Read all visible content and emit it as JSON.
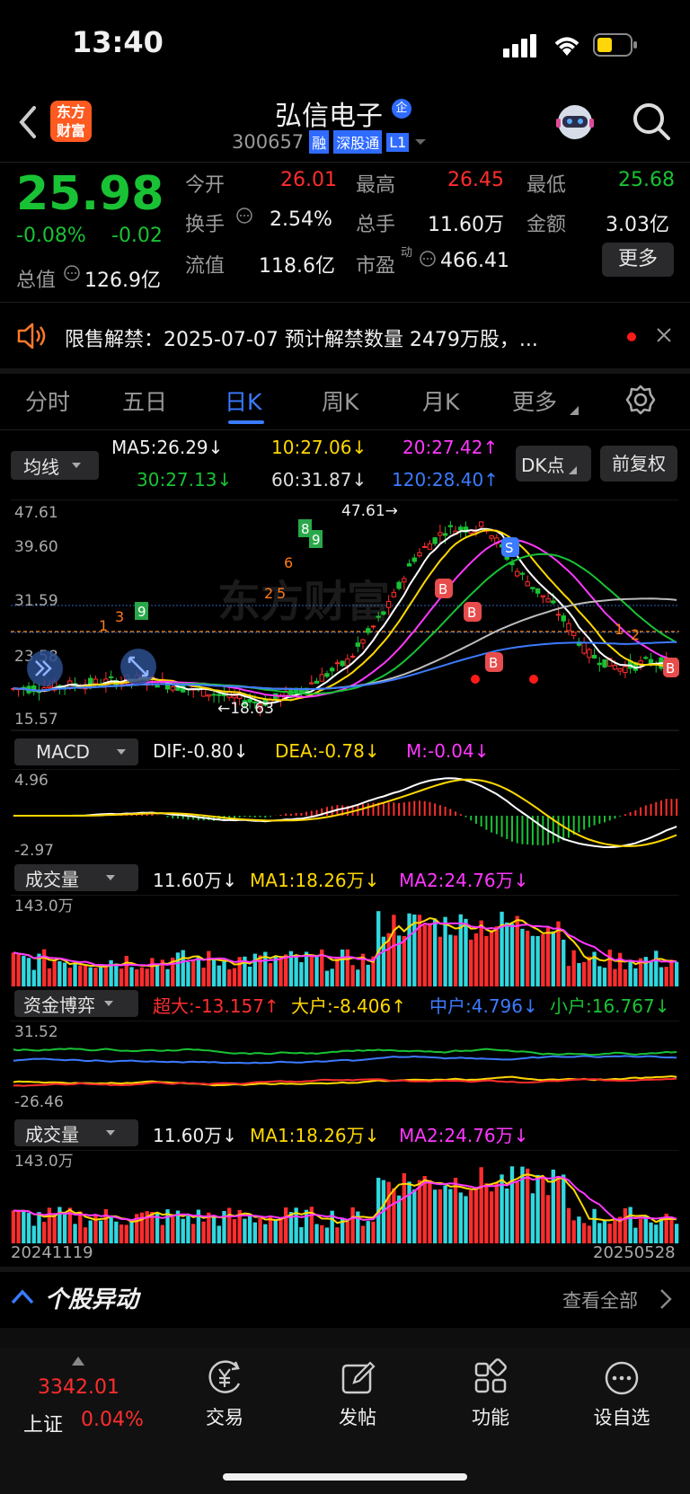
{
  "status_bar": {
    "time": "13:40"
  },
  "header": {
    "logo": {
      "line1": "东方",
      "line2": "财富"
    },
    "stock_name": "弘信电子",
    "badge_qi": "企",
    "stock_code": "300657",
    "tag_rong": "融",
    "tag_sgt": "深股通",
    "tag_l1": "L1"
  },
  "quote": {
    "price": "25.98",
    "change_pct": "-0.08%",
    "change": "-0.02",
    "labels": {
      "open": "今开",
      "high": "最高",
      "low": "最低",
      "turnover": "换手",
      "volume": "总手",
      "amount": "金额",
      "market_cap": "总值",
      "float_cap": "流值",
      "pe": "市盈",
      "pe_sup": "动"
    },
    "values": {
      "open": "26.01",
      "high": "26.45",
      "low": "25.68",
      "turnover": "2.54%",
      "volume": "11.60万",
      "amount": "3.03亿",
      "market_cap": "126.9亿",
      "float_cap": "118.6亿",
      "pe": "466.41"
    },
    "more_label": "更多"
  },
  "notice": {
    "text": "限售解禁：2025-07-07 预计解禁数量 2479万股，..."
  },
  "tabs": [
    {
      "label": "分时"
    },
    {
      "label": "五日"
    },
    {
      "label": "日K"
    },
    {
      "label": "周K"
    },
    {
      "label": "月K"
    },
    {
      "label": "更多"
    }
  ],
  "ma_panel": {
    "selector": "均线",
    "ma5": "MA5:26.29↓",
    "ma10": "10:27.06↓",
    "ma20": "20:27.42↑",
    "ma30": "30:27.13↓",
    "ma60": "60:31.87↓",
    "ma120": "120:28.40↑",
    "dk_button": "DK点",
    "adjust_button": "前复权"
  },
  "colors": {
    "up": "#ff2d2d",
    "down": "#19c234",
    "ma5": "#ffffff",
    "ma10": "#ffd800",
    "ma20": "#ff38ff",
    "ma30": "#19c234",
    "ma60": "#bbbbbb",
    "ma120": "#3c7bff",
    "cyan_bar": "#30d8e0",
    "accent": "#3a7bff"
  },
  "chart_data": [
    {
      "type": "candlestick",
      "y_ticks": [
        "47.61",
        "39.60",
        "31.59",
        "23.58",
        "15.57"
      ],
      "ylim": [
        15.57,
        47.61
      ],
      "annotations": {
        "high": "47.61→",
        "low": "←18.63"
      },
      "markers": [
        "9",
        "8",
        "6",
        "2",
        "5",
        "3",
        "1",
        "B",
        "S"
      ],
      "watermark": "东方财富"
    },
    {
      "type": "line",
      "indicator": "MACD",
      "selector": "MACD",
      "dif": "DIF:-0.80↓",
      "dea": "DEA:-0.78↓",
      "m": "M:-0.04↓",
      "y_ticks": [
        "4.96",
        "-2.97"
      ]
    },
    {
      "type": "bar",
      "selector": "成交量",
      "vol": "11.60万↓",
      "ma1": "MA1:18.26万↓",
      "ma2": "MA2:24.76万↓",
      "y_ticks": [
        "143.0万"
      ]
    },
    {
      "type": "line",
      "selector": "资金博弈",
      "super": "超大:-13.157↑",
      "large": "大户:-8.406↑",
      "mid": "中户:4.796↓",
      "small": "小户:16.767↓",
      "y_ticks": [
        "31.52",
        "-26.46"
      ]
    },
    {
      "type": "bar",
      "selector": "成交量",
      "vol": "11.60万↓",
      "ma1": "MA1:18.26万↓",
      "ma2": "MA2:24.76万↓",
      "y_ticks": [
        "143.0万"
      ],
      "x_range": [
        "20241119",
        "20250528"
      ]
    }
  ],
  "movers": {
    "title": "个股异动",
    "view_all": "查看全部"
  },
  "bottom_nav": {
    "index_value": "3342.01",
    "index_name": "上证",
    "index_change": "0.04%",
    "items": [
      {
        "label": "交易"
      },
      {
        "label": "发帖"
      },
      {
        "label": "功能"
      },
      {
        "label": "设自选"
      }
    ]
  }
}
